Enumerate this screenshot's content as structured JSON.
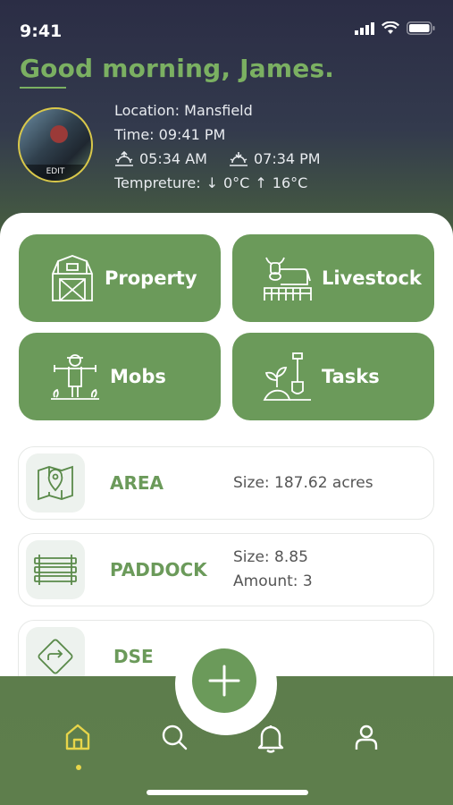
{
  "status": {
    "time": "9:41"
  },
  "header": {
    "greeting": "Good morning, James.",
    "avatar_edit": "EDIT",
    "location": "Location: Mansfield",
    "time": "Time: 09:41 PM",
    "sunrise": "05:34 AM",
    "sunset": "07:34 PM",
    "temp_label": "Tempreture:",
    "temp_min": "0°C",
    "temp_max": "16°C"
  },
  "tiles": [
    {
      "label": "Property",
      "icon": "barn-icon"
    },
    {
      "label": "Livestock",
      "icon": "cow-icon"
    },
    {
      "label": "Mobs",
      "icon": "scarecrow-icon"
    },
    {
      "label": "Tasks",
      "icon": "shovel-plant-icon"
    }
  ],
  "cards": [
    {
      "title": "AREA",
      "lines": [
        "Size: 187.62 acres"
      ],
      "icon": "map-pin-icon"
    },
    {
      "title": "PADDOCK",
      "lines": [
        "Size: 8.85",
        "Amount: 3"
      ],
      "icon": "fence-icon"
    },
    {
      "title": "DSE",
      "lines": [],
      "icon": "direction-sign-icon"
    }
  ],
  "nav": [
    "home",
    "search",
    "notifications",
    "profile"
  ],
  "colors": {
    "accent": "#6b9a5a",
    "greeting": "#7bb062",
    "active_dot": "#e7d54a"
  }
}
